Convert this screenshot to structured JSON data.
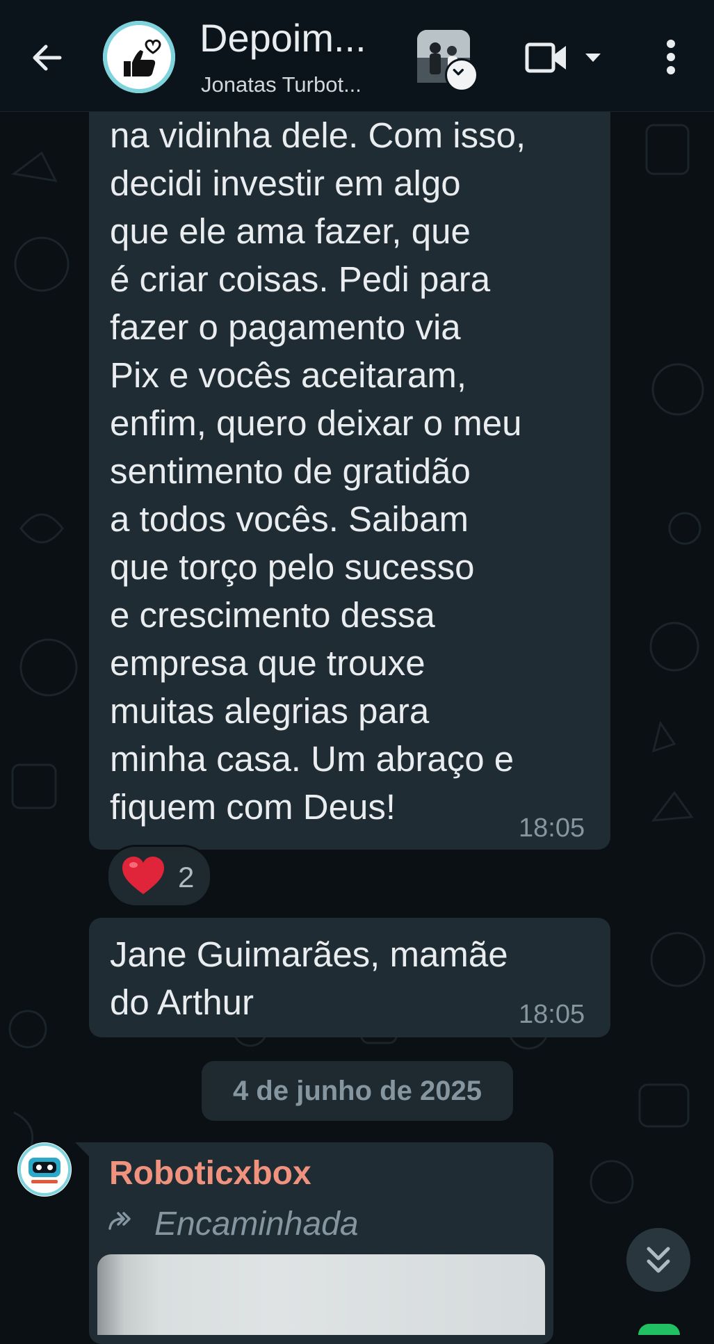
{
  "header": {
    "back_icon": "arrow-back-icon",
    "group_avatar_icon": "thumbs-up-heart-icon",
    "title": "Depoim...",
    "subtitle": "Jonatas Turbot...",
    "status_thumb": "status-photo-thumbnail",
    "status_badge_icon": "chevron-down-icon",
    "video_icon": "video-camera-icon",
    "video_dropdown_icon": "caret-down-icon",
    "menu_icon": "more-vertical-icon"
  },
  "messages": [
    {
      "lines": [
        "na vidinha dele. Com isso,",
        "decidi investir em algo",
        "que ele ama fazer, que",
        "é criar coisas. Pedi para",
        "fazer o pagamento via",
        "Pix e vocês aceitaram,",
        "enfim, quero deixar o meu",
        "sentimento de gratidão",
        "a todos vocês. Saibam",
        "que torço pelo sucesso",
        "e crescimento dessa",
        "empresa que trouxe",
        "muitas alegrias para",
        "minha casa. Um abraço e",
        "fiquem com Deus!"
      ],
      "time": "18:05",
      "reaction": {
        "emoji_icon": "red-heart-icon",
        "count": "2"
      }
    },
    {
      "lines": [
        "Jane Guimarães, mamãe",
        "do Arthur"
      ],
      "time": "18:05"
    }
  ],
  "date_separator": "4 de junho de 2025",
  "forwarded_message": {
    "sender": "Roboticxbox",
    "sender_avatar": "roboticxbox-logo",
    "forward_icon": "forward-arrows-icon",
    "forward_label": "Encaminhada",
    "media": "photo-preview"
  },
  "scroll_down_icon": "double-chevron-down-icon",
  "colors": {
    "background": "#0b1014",
    "header": "#0b141a",
    "bubble_incoming": "#202c33",
    "text": "#e9edef",
    "meta": "#8696a0",
    "sender_name": "#f0927d",
    "heart": "#e0243a",
    "fab": "#21c063"
  }
}
